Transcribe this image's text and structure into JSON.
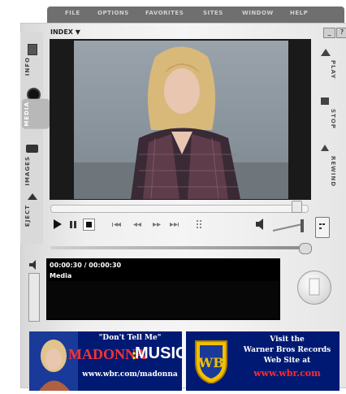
{
  "menu": {
    "items": [
      "FILE",
      "OPTIONS",
      "FAVORITES",
      "SITES",
      "WINDOW",
      "HELP"
    ]
  },
  "header": {
    "index_label": "INDEX ▼",
    "minimize": "_",
    "close": "?"
  },
  "side_tabs": [
    "INFO",
    "MEDIA",
    "IMAGES",
    "EJECT"
  ],
  "right_tabs": [
    "PLAY",
    "STOP",
    "REWIND"
  ],
  "player": {
    "time": "00:00:30 / 00:00:30",
    "category": "Media",
    "progress_fraction": 0.96
  },
  "banners": {
    "left": {
      "quote": "\"Don't Tell Me\"",
      "artist": "MADONNA",
      "music": "MUSIC",
      "url": "www.wbr.com/madonna"
    },
    "right": {
      "logo": "WB",
      "line1": "Visit the",
      "line2": "Warner Bros Records",
      "line3": "Web Site at",
      "url": "www.wbr.com"
    }
  },
  "colors": {
    "banner_bg": "#001a73",
    "url_red": "#ff2a2a",
    "music_yellow": "#ffe800",
    "madonna_red": "#ff3030"
  }
}
